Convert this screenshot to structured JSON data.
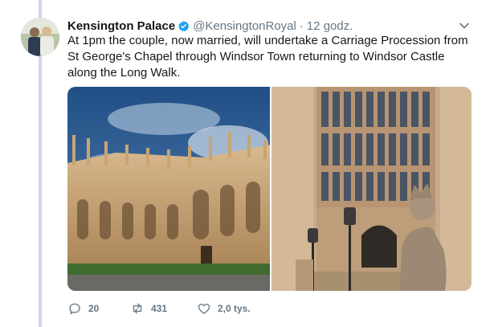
{
  "tweet": {
    "author_name": "Kensington Palace",
    "handle": "@KensingtonRoyal",
    "separator": "·",
    "timestamp": "12 godz.",
    "text": "At 1pm the couple, now married, will undertake a Carriage Procession from St George's Chapel through Windsor Town returning to Windsor Castle along the Long Walk.",
    "media": [
      {
        "icon": "photo-st-georges-chapel-exterior"
      },
      {
        "icon": "photo-chapel-entrance-lion-statue"
      }
    ],
    "actions": {
      "reply_count": "20",
      "retweet_count": "431",
      "like_count": "2,0 tys."
    }
  },
  "colors": {
    "thread_line": "#ddd0ea",
    "verified": "#1da1f2",
    "secondary_text": "#657786"
  }
}
